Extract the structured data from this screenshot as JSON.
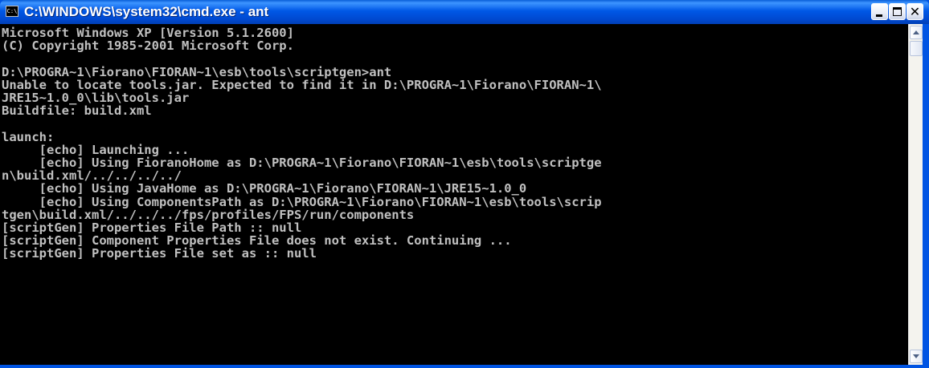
{
  "window": {
    "title": "C:\\WINDOWS\\system32\\cmd.exe - ant",
    "icon_text": "C:\\"
  },
  "icons": {
    "app": "cmd-icon",
    "minimize": "minimize-icon",
    "maximize": "maximize-icon",
    "close": "close-icon",
    "scroll_up": "arrow-up-icon",
    "scroll_down": "arrow-down-icon"
  },
  "colors": {
    "titlebar": "#0054e3",
    "console_background": "#000000",
    "console_text": "#c0c0c0"
  },
  "console": {
    "lines": [
      "Microsoft Windows XP [Version 5.1.2600]",
      "(C) Copyright 1985-2001 Microsoft Corp.",
      "",
      "D:\\PROGRA~1\\Fiorano\\FIORAN~1\\esb\\tools\\scriptgen>ant",
      "Unable to locate tools.jar. Expected to find it in D:\\PROGRA~1\\Fiorano\\FIORAN~1\\",
      "JRE15~1.0_0\\lib\\tools.jar",
      "Buildfile: build.xml",
      "",
      "launch:",
      "     [echo] Launching ...",
      "     [echo] Using FioranoHome as D:\\PROGRA~1\\Fiorano\\FIORAN~1\\esb\\tools\\scriptge",
      "n\\build.xml/../../../../",
      "     [echo] Using JavaHome as D:\\PROGRA~1\\Fiorano\\FIORAN~1\\JRE15~1.0_0",
      "     [echo] Using ComponentsPath as D:\\PROGRA~1\\Fiorano\\FIORAN~1\\esb\\tools\\scrip",
      "tgen\\build.xml/../../../fps/profiles/FPS/run/components",
      "[scriptGen] Properties File Path :: null",
      "[scriptGen] Component Properties File does not exist. Continuing ...",
      "[scriptGen] Properties File set as :: null"
    ]
  }
}
